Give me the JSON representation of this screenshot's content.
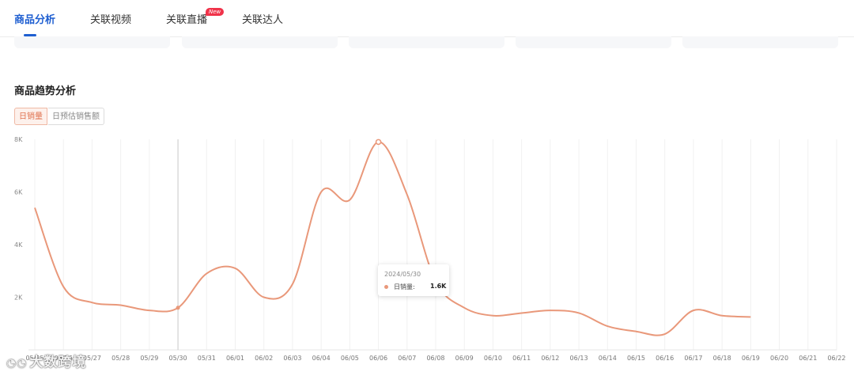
{
  "tabs": [
    {
      "label": "商品分析",
      "active": true
    },
    {
      "label": "关联视频",
      "active": false
    },
    {
      "label": "关联直播",
      "active": false,
      "badge": "New"
    },
    {
      "label": "关联达人",
      "active": false
    }
  ],
  "section": {
    "title": "商品趋势分析"
  },
  "metric_toggle": {
    "options": [
      "日销量",
      "日预估销售额"
    ],
    "selected": "日销量"
  },
  "tooltip": {
    "date": "2024/05/30",
    "label": "日销量:",
    "value": "1.6K"
  },
  "watermark": {
    "text": "大数跨境"
  },
  "colors": {
    "accent": "#1f5fd1",
    "line": "#e9987a",
    "badge": "#f0334a"
  },
  "chart_data": {
    "type": "line",
    "title": "",
    "xlabel": "",
    "ylabel": "",
    "yticks": [
      "2K",
      "4K",
      "6K",
      "8K"
    ],
    "yticks_values": [
      2000,
      4000,
      6000,
      8000
    ],
    "ylim": [
      0,
      8000
    ],
    "categories": [
      "05/25",
      "05/26",
      "05/27",
      "05/28",
      "05/29",
      "05/30",
      "05/31",
      "06/01",
      "06/02",
      "06/03",
      "06/04",
      "06/05",
      "06/06",
      "06/07",
      "06/08",
      "06/09",
      "06/10",
      "06/11",
      "06/12",
      "06/13",
      "06/14",
      "06/15",
      "06/16",
      "06/17",
      "06/18",
      "06/19",
      "06/20",
      "06/21",
      "06/22"
    ],
    "series": [
      {
        "values": [
          5400,
          2400,
          1800,
          1700,
          1500,
          1600,
          2900,
          3100,
          2000,
          2500,
          6000,
          5700,
          7900,
          5900,
          2600,
          1600,
          1300,
          1400,
          1500,
          1400,
          900,
          700,
          600,
          1500,
          1300,
          1250
        ]
      }
    ],
    "series_note_values_start_index": 0,
    "highlight_category": "05/30",
    "grid": true
  }
}
